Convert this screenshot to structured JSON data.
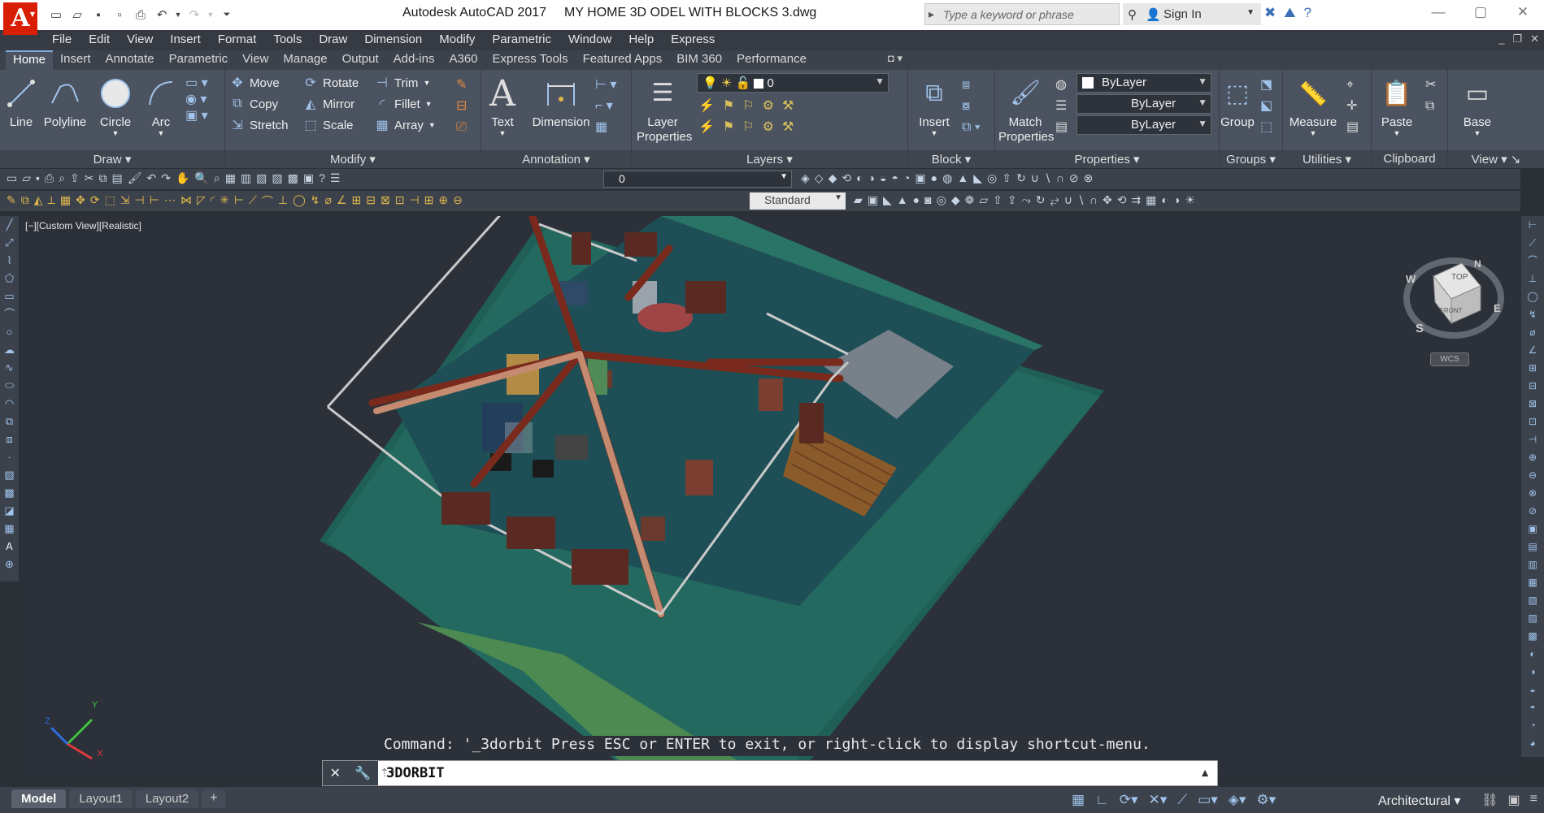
{
  "titlebar": {
    "app_name": "Autodesk AutoCAD 2017",
    "file_name": "MY HOME 3D ODEL WITH BLOCKS 3.dwg",
    "search_placeholder": "Type a keyword or phrase",
    "sign_in": "Sign In",
    "logo": "A"
  },
  "menu": [
    "File",
    "Edit",
    "View",
    "Insert",
    "Format",
    "Tools",
    "Draw",
    "Dimension",
    "Modify",
    "Parametric",
    "Window",
    "Help",
    "Express"
  ],
  "ribbon_tabs": [
    "Home",
    "Insert",
    "Annotate",
    "Parametric",
    "View",
    "Manage",
    "Output",
    "Add-ins",
    "A360",
    "Express Tools",
    "Featured Apps",
    "BIM 360",
    "Performance"
  ],
  "ribbon": {
    "draw": {
      "title": "Draw",
      "line": "Line",
      "polyline": "Polyline",
      "circle": "Circle",
      "arc": "Arc"
    },
    "modify": {
      "title": "Modify",
      "move": "Move",
      "rotate": "Rotate",
      "trim": "Trim",
      "copy": "Copy",
      "mirror": "Mirror",
      "fillet": "Fillet",
      "stretch": "Stretch",
      "scale": "Scale",
      "array": "Array"
    },
    "annotation": {
      "title": "Annotation",
      "text": "Text",
      "dimension": "Dimension"
    },
    "layers": {
      "title": "Layers",
      "layer_properties_1": "Layer",
      "layer_properties_2": "Properties",
      "current_layer": "0"
    },
    "block": {
      "title": "Block",
      "insert": "Insert"
    },
    "properties": {
      "title": "Properties",
      "match_1": "Match",
      "match_2": "Properties",
      "color": "ByLayer",
      "linetype": "ByLayer",
      "lineweight": "ByLayer"
    },
    "groups": {
      "title": "Groups",
      "group": "Group"
    },
    "utilities": {
      "title": "Utilities",
      "measure": "Measure"
    },
    "clipboard": {
      "title": "Clipboard",
      "paste": "Paste"
    },
    "view": {
      "title": "View",
      "base": "Base"
    }
  },
  "toolbar": {
    "layer_value": "0",
    "text_style": "Standard"
  },
  "viewport": {
    "label": "[−][Custom View][Realistic]",
    "viewcube": {
      "top": "TOP",
      "front": "FRONT",
      "n": "N",
      "w": "W",
      "s": "S",
      "e": "E",
      "wcs": "WCS"
    },
    "ucs": {
      "x": "X",
      "y": "Y",
      "z": "Z"
    }
  },
  "command": {
    "history": "Command: '_3dorbit Press ESC or ENTER to exit, or right-click to display shortcut-menu.",
    "input": "3DORBIT"
  },
  "status": {
    "tabs": [
      "Model",
      "Layout1",
      "Layout2"
    ],
    "add_tab": "+",
    "units": "Architectural"
  },
  "colors": {
    "accent": "#d81e05",
    "ribbon_bg": "#4c5360",
    "viewport_bg": "#2b3039",
    "ground": "#1f5f58",
    "floor_green": "#4c8a52",
    "beam": "#7a2a1c",
    "wall": "#c58b70"
  }
}
